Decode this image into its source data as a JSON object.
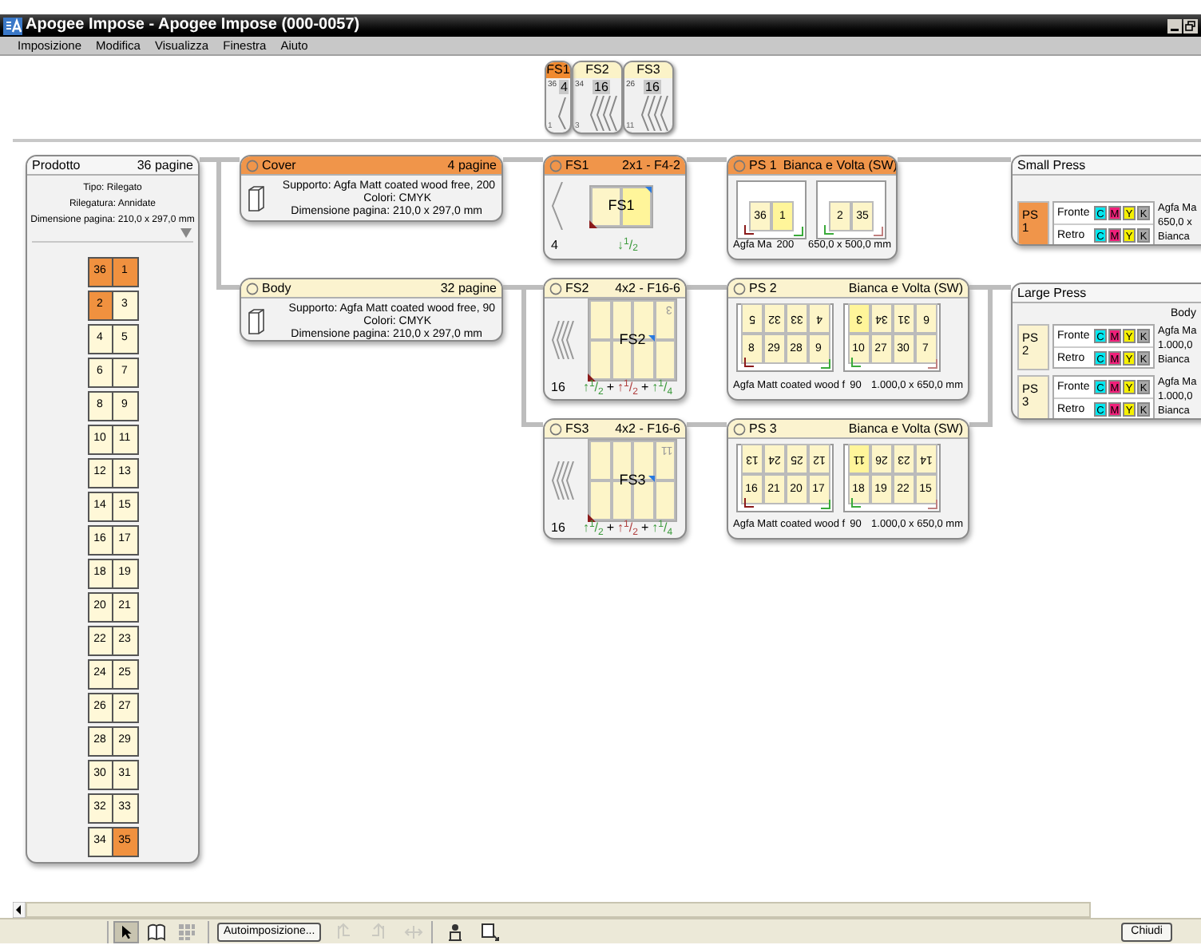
{
  "window": {
    "title": "Apogee Impose - Apogee Impose (000-0057)"
  },
  "menu": [
    {
      "label": "Imposizione"
    },
    {
      "label": "Modifica"
    },
    {
      "label": "Visualizza"
    },
    {
      "label": "Finestra"
    },
    {
      "label": "Aiuto"
    }
  ],
  "fs_tabs": [
    {
      "label": "FS1",
      "selected": true,
      "top_page": "36",
      "count": "4",
      "bottom_page": "1",
      "kind": "single"
    },
    {
      "label": "FS2",
      "selected": false,
      "top_page": "34",
      "count": "16",
      "bottom_page": "3",
      "kind": "multi"
    },
    {
      "label": "FS3",
      "selected": false,
      "top_page": "26",
      "count": "16",
      "bottom_page": "11",
      "kind": "multi"
    }
  ],
  "product": {
    "title": "Prodotto",
    "pages": "36 pagine",
    "details": [
      "Tipo: Rilegato",
      "Rilegatura: Annidate",
      "Dimensione pagina: 210,0 x 297,0 mm"
    ],
    "spreads": [
      {
        "pages": [
          {
            "page": "36",
            "selected": true
          },
          {
            "page": "1",
            "selected": true
          }
        ]
      },
      {
        "pages": [
          {
            "page": "2",
            "selected": true
          },
          {
            "page": "3",
            "selected": false
          }
        ]
      },
      {
        "pages": [
          {
            "page": "4",
            "selected": false
          },
          {
            "page": "5",
            "selected": false
          }
        ]
      },
      {
        "pages": [
          {
            "page": "6",
            "selected": false
          },
          {
            "page": "7",
            "selected": false
          }
        ]
      },
      {
        "pages": [
          {
            "page": "8",
            "selected": false
          },
          {
            "page": "9",
            "selected": false
          }
        ]
      },
      {
        "pages": [
          {
            "page": "10",
            "selected": false
          },
          {
            "page": "11",
            "selected": false
          }
        ]
      },
      {
        "pages": [
          {
            "page": "12",
            "selected": false
          },
          {
            "page": "13",
            "selected": false
          }
        ]
      },
      {
        "pages": [
          {
            "page": "14",
            "selected": false
          },
          {
            "page": "15",
            "selected": false
          }
        ]
      },
      {
        "pages": [
          {
            "page": "16",
            "selected": false
          },
          {
            "page": "17",
            "selected": false
          }
        ]
      },
      {
        "pages": [
          {
            "page": "18",
            "selected": false
          },
          {
            "page": "19",
            "selected": false
          }
        ]
      },
      {
        "pages": [
          {
            "page": "20",
            "selected": false
          },
          {
            "page": "21",
            "selected": false
          }
        ]
      },
      {
        "pages": [
          {
            "page": "22",
            "selected": false
          },
          {
            "page": "23",
            "selected": false
          }
        ]
      },
      {
        "pages": [
          {
            "page": "24",
            "selected": false
          },
          {
            "page": "25",
            "selected": false
          }
        ]
      },
      {
        "pages": [
          {
            "page": "26",
            "selected": false
          },
          {
            "page": "27",
            "selected": false
          }
        ]
      },
      {
        "pages": [
          {
            "page": "28",
            "selected": false
          },
          {
            "page": "29",
            "selected": false
          }
        ]
      },
      {
        "pages": [
          {
            "page": "30",
            "selected": false
          },
          {
            "page": "31",
            "selected": false
          }
        ]
      },
      {
        "pages": [
          {
            "page": "32",
            "selected": false
          },
          {
            "page": "33",
            "selected": false
          }
        ]
      },
      {
        "pages": [
          {
            "page": "34",
            "selected": false
          },
          {
            "page": "35",
            "selected": true
          }
        ]
      }
    ]
  },
  "parts": [
    {
      "title": "Cover",
      "pages": "4 pagine",
      "selected": true,
      "details": [
        "Supporto: Agfa Matt coated wood free, 200",
        "Colori: CMYK",
        "Dimensione pagina: 210,0 x 297,0 mm"
      ]
    },
    {
      "title": "Body",
      "pages": "32 pagine",
      "selected": false,
      "details": [
        "Supporto: Agfa Matt coated wood free, 90",
        "Colori: CMYK",
        "Dimensione pagina: 210,0 x 297,0 mm"
      ]
    }
  ],
  "fold_sheets": [
    {
      "title": "FS1",
      "scheme": "2x1 - F4-2",
      "selected": true,
      "kind": "small",
      "sheet_label": "FS1",
      "page_count": "4",
      "fold_formula": [
        {
          "text": "↓$^{1}$/$_{2}$",
          "color": "#3c9a3c"
        }
      ]
    },
    {
      "title": "FS2",
      "scheme": "4x2 - F16-6",
      "selected": false,
      "kind": "large",
      "sheet_label": "FS2",
      "corner_page": "3",
      "page_count": "16",
      "fold_joiner": "+",
      "fold_formula": [
        {
          "text": "↑$^{1}$/$_{2}$",
          "color": "#3c9a3c"
        },
        {
          "text": "↑$^{1}$/$_{2}$",
          "color": "#b04040"
        },
        {
          "text": "↑$^{1}$/$_{4}$",
          "color": "#3c9a3c"
        }
      ]
    },
    {
      "title": "FS3",
      "scheme": "4x2 - F16-6",
      "selected": false,
      "kind": "large",
      "sheet_label": "FS3",
      "corner_page": "11",
      "page_count": "16",
      "fold_joiner": "+",
      "fold_formula": [
        {
          "text": "↑$^{1}$/$_{2}$",
          "color": "#3c9a3c"
        },
        {
          "text": "↑$^{1}$/$_{2}$",
          "color": "#b04040"
        },
        {
          "text": "↑$^{1}$/$_{4}$",
          "color": "#3c9a3c"
        }
      ]
    }
  ],
  "press_sheets": [
    {
      "title": "PS 1",
      "mode": "Bianca e Volta (SW)",
      "selected": true,
      "stock": "Agfa Ma",
      "weight": "200",
      "size": "650,0 x 500,0 mm",
      "sides": [
        {
          "rows": [
            {
              "inverted": false,
              "pages": [
                {
                  "page": "36",
                  "selected": false
                },
                {
                  "page": "1",
                  "selected": true
                }
              ]
            }
          ]
        },
        {
          "rows": [
            {
              "inverted": false,
              "pages": [
                {
                  "page": "2",
                  "selected": false
                },
                {
                  "page": "35",
                  "selected": false
                }
              ]
            }
          ]
        }
      ]
    },
    {
      "title": "PS 2",
      "mode": "Bianca e Volta (SW)",
      "selected": false,
      "stock": "Agfa Matt coated wood f",
      "weight": "90",
      "size": "1.000,0 x 650,0 mm",
      "sides": [
        {
          "rows": [
            {
              "inverted": true,
              "pages": [
                {
                  "page": "5",
                  "selected": false
                },
                {
                  "page": "32",
                  "selected": false
                },
                {
                  "page": "33",
                  "selected": false
                },
                {
                  "page": "4",
                  "selected": false
                }
              ]
            },
            {
              "inverted": false,
              "pages": [
                {
                  "page": "8",
                  "selected": false
                },
                {
                  "page": "29",
                  "selected": false
                },
                {
                  "page": "28",
                  "selected": false
                },
                {
                  "page": "9",
                  "selected": false
                }
              ]
            }
          ]
        },
        {
          "rows": [
            {
              "inverted": true,
              "pages": [
                {
                  "page": "3",
                  "selected": true
                },
                {
                  "page": "34",
                  "selected": false
                },
                {
                  "page": "31",
                  "selected": false
                },
                {
                  "page": "6",
                  "selected": false
                }
              ]
            },
            {
              "inverted": false,
              "pages": [
                {
                  "page": "10",
                  "selected": false
                },
                {
                  "page": "27",
                  "selected": false
                },
                {
                  "page": "30",
                  "selected": false
                },
                {
                  "page": "7",
                  "selected": false
                }
              ]
            }
          ]
        }
      ]
    },
    {
      "title": "PS 3",
      "mode": "Bianca e Volta (SW)",
      "selected": false,
      "stock": "Agfa Matt coated wood f",
      "weight": "90",
      "size": "1.000,0 x 650,0 mm",
      "sides": [
        {
          "rows": [
            {
              "inverted": true,
              "pages": [
                {
                  "page": "13",
                  "selected": false
                },
                {
                  "page": "24",
                  "selected": false
                },
                {
                  "page": "25",
                  "selected": false
                },
                {
                  "page": "12",
                  "selected": false
                }
              ]
            },
            {
              "inverted": false,
              "pages": [
                {
                  "page": "16",
                  "selected": false
                },
                {
                  "page": "21",
                  "selected": false
                },
                {
                  "page": "20",
                  "selected": false
                },
                {
                  "page": "17",
                  "selected": false
                }
              ]
            }
          ]
        },
        {
          "rows": [
            {
              "inverted": true,
              "pages": [
                {
                  "page": "11",
                  "selected": true
                },
                {
                  "page": "26",
                  "selected": false
                },
                {
                  "page": "23",
                  "selected": false
                },
                {
                  "page": "14",
                  "selected": false
                }
              ]
            },
            {
              "inverted": false,
              "pages": [
                {
                  "page": "18",
                  "selected": false
                },
                {
                  "page": "19",
                  "selected": false
                },
                {
                  "page": "22",
                  "selected": false
                },
                {
                  "page": "15",
                  "selected": false
                }
              ]
            }
          ]
        }
      ]
    }
  ],
  "presses": [
    {
      "title": "Small Press",
      "sheets": [
        {
          "label": "PS 1",
          "selected": true,
          "info": [
            "Agfa Ma",
            "650,0 x",
            "Bianca"
          ],
          "sides": [
            {
              "name": "Fronte",
              "inks": [
                {
                  "label": "C",
                  "color": "#00e8f0"
                },
                {
                  "label": "M",
                  "color": "#f0207a"
                },
                {
                  "label": "Y",
                  "color": "#f5f000"
                },
                {
                  "label": "K",
                  "color": "#a8a8a8"
                }
              ]
            },
            {
              "name": "Retro",
              "inks": [
                {
                  "label": "C",
                  "color": "#00e8f0"
                },
                {
                  "label": "M",
                  "color": "#f0207a"
                },
                {
                  "label": "Y",
                  "color": "#f5f000"
                },
                {
                  "label": "K",
                  "color": "#a8a8a8"
                }
              ]
            }
          ]
        }
      ]
    },
    {
      "title": "Large Press",
      "part": "Body",
      "sheets": [
        {
          "label": "PS 2",
          "selected": false,
          "info": [
            "Agfa Ma",
            "1.000,0",
            "Bianca"
          ],
          "sides": [
            {
              "name": "Fronte",
              "inks": [
                {
                  "label": "C",
                  "color": "#00e8f0"
                },
                {
                  "label": "M",
                  "color": "#f0207a"
                },
                {
                  "label": "Y",
                  "color": "#f5f000"
                },
                {
                  "label": "K",
                  "color": "#a8a8a8"
                }
              ]
            },
            {
              "name": "Retro",
              "inks": [
                {
                  "label": "C",
                  "color": "#00e8f0"
                },
                {
                  "label": "M",
                  "color": "#f0207a"
                },
                {
                  "label": "Y",
                  "color": "#f5f000"
                },
                {
                  "label": "K",
                  "color": "#a8a8a8"
                }
              ]
            }
          ]
        },
        {
          "label": "PS 3",
          "selected": false,
          "info": [
            "Agfa Ma",
            "1.000,0",
            "Bianca"
          ],
          "sides": [
            {
              "name": "Fronte",
              "inks": [
                {
                  "label": "C",
                  "color": "#00e8f0"
                },
                {
                  "label": "M",
                  "color": "#f0207a"
                },
                {
                  "label": "Y",
                  "color": "#f5f000"
                },
                {
                  "label": "K",
                  "color": "#a8a8a8"
                }
              ]
            },
            {
              "name": "Retro",
              "inks": [
                {
                  "label": "C",
                  "color": "#00e8f0"
                },
                {
                  "label": "M",
                  "color": "#f0207a"
                },
                {
                  "label": "Y",
                  "color": "#f5f000"
                },
                {
                  "label": "K",
                  "color": "#a8a8a8"
                }
              ]
            }
          ]
        }
      ]
    }
  ],
  "toolbar": {
    "tools": [
      {
        "kind": "pointer",
        "selected": true
      },
      {
        "kind": "book",
        "selected": false
      },
      {
        "kind": "grid",
        "selected": false
      }
    ],
    "autoimpose": "Autoimposizione...",
    "actions": [
      {
        "kind": "left",
        "disabled": true
      },
      {
        "kind": "right",
        "disabled": true
      },
      {
        "kind": "move",
        "disabled": true
      },
      {
        "kind": "person",
        "disabled": false
      },
      {
        "kind": "export",
        "disabled": false
      }
    ],
    "close": "Chiudi"
  }
}
